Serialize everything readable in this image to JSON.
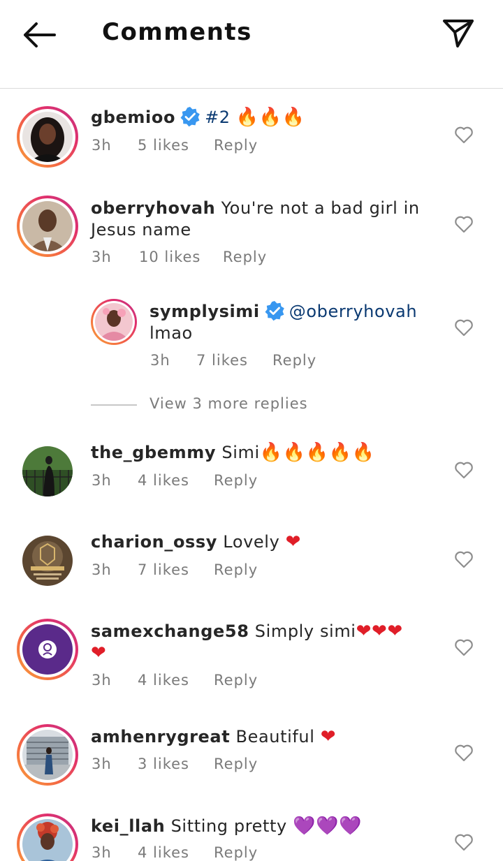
{
  "header": {
    "title": "Comments",
    "back_icon": "arrow-left-icon",
    "send_icon": "paper-plane-icon"
  },
  "colors": {
    "ring_start": "#f9a23b",
    "ring_end": "#c13584",
    "verified": "#3897f0",
    "mention": "#0b3a72",
    "meta": "#7a7a7a"
  },
  "comments": [
    {
      "username": "gbemioo",
      "verified": true,
      "text": "#2",
      "emojis": "🔥🔥🔥",
      "time": "3h",
      "likes": "5 likes",
      "reply": "Reply"
    },
    {
      "username": "oberryhovah",
      "verified": false,
      "text": "You're not a bad girl in",
      "text2": "Jesus name",
      "time": "3h",
      "likes": "10 likes",
      "reply": "Reply"
    },
    {
      "username": "symplysimi",
      "verified": true,
      "mention": "@oberryhovah",
      "text2": "lmao",
      "time": "3h",
      "likes": "7 likes",
      "reply": "Reply"
    },
    {
      "username": "the_gbemmy",
      "verified": false,
      "text": "Simi",
      "emojis": "🔥🔥🔥🔥🔥",
      "time": "3h",
      "likes": "4 likes",
      "reply": "Reply"
    },
    {
      "username": "charion_ossy",
      "verified": false,
      "text": "Lovely",
      "emojis": "❤",
      "time": "3h",
      "likes": "7 likes",
      "reply": "Reply"
    },
    {
      "username": "samexchange58",
      "verified": false,
      "text": "Simply simi",
      "emojis": "❤❤❤",
      "emojis2": "❤",
      "time": "3h",
      "likes": "4 likes",
      "reply": "Reply"
    },
    {
      "username": "amhenrygreat",
      "verified": false,
      "text": "Beautiful",
      "emojis": "❤",
      "time": "3h",
      "likes": "3 likes",
      "reply": "Reply"
    },
    {
      "username": "kei_llah",
      "verified": false,
      "text": "Sitting pretty",
      "emojis": "💜💜💜",
      "time": "3h",
      "likes": "4 likes",
      "reply": "Reply"
    }
  ],
  "view_more_replies": "View 3 more replies"
}
